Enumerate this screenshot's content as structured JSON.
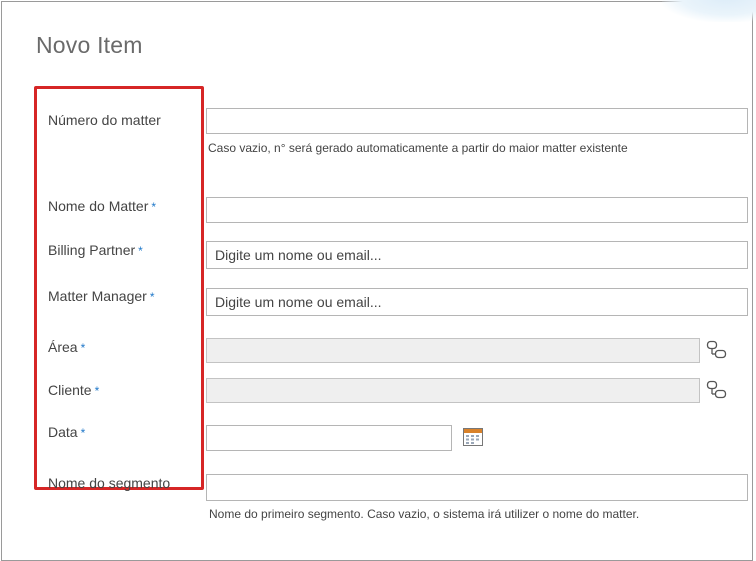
{
  "form": {
    "title": "Novo Item",
    "fields": {
      "numero_matter": {
        "label": "Número do matter",
        "value": "",
        "hint": "Caso vazio, n° será gerado automaticamente a partir do maior matter existente"
      },
      "nome_matter": {
        "label": "Nome do Matter",
        "required_mark": "*",
        "value": ""
      },
      "billing_partner": {
        "label": "Billing Partner",
        "required_mark": "*",
        "placeholder": "Digite um nome ou email..."
      },
      "matter_manager": {
        "label": "Matter Manager",
        "required_mark": "*",
        "placeholder": "Digite um nome ou email..."
      },
      "area": {
        "label": "Área",
        "required_mark": "*",
        "value": "",
        "icon": "lookup-icon"
      },
      "cliente": {
        "label": "Cliente",
        "required_mark": "*",
        "value": "",
        "icon": "lookup-icon"
      },
      "data": {
        "label": "Data",
        "required_mark": "*",
        "value": "",
        "icon": "calendar-icon"
      },
      "nome_segmento": {
        "label": "Nome do segmento",
        "value": "",
        "hint": "Nome do primeiro segmento. Caso vazio, o sistema irá utilizer o nome do matter."
      }
    }
  },
  "colors": {
    "highlight_border": "#d62626",
    "required_mark": "#1f78c9",
    "disabled_field": "#efefef"
  }
}
